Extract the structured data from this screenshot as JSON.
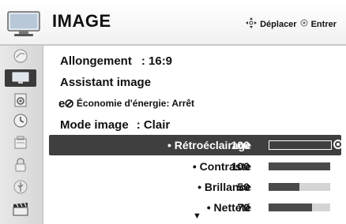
{
  "header": {
    "title": "IMAGE",
    "nav_move": "Déplacer",
    "nav_enter": "Entrer",
    "move_icon": "dpad-icon",
    "enter_icon": "ok-circle-icon"
  },
  "sidebar": {
    "items": [
      {
        "icon": "satellite-dish-icon",
        "active": false
      },
      {
        "icon": "tv-screen-icon",
        "active": true
      },
      {
        "icon": "speaker-icon",
        "active": false
      },
      {
        "icon": "clock-icon",
        "active": false
      },
      {
        "icon": "options-icon",
        "active": false
      },
      {
        "icon": "lock-icon",
        "active": false
      },
      {
        "icon": "usb-icon",
        "active": false
      },
      {
        "icon": "movie-clapper-icon",
        "active": false
      }
    ]
  },
  "menu": {
    "aspect_label": "Allongement",
    "aspect_value": ": 16:9",
    "assistant_label": "Assistant image",
    "energy_logo": "e⊘",
    "energy_label": "Économie d'énergie: Arrêt",
    "mode_label": "Mode image",
    "mode_value": ": Clair",
    "settings": [
      {
        "label": "• Rétroéclairage",
        "value": "100",
        "level": 1.0,
        "selected": true
      },
      {
        "label": "• Contraste",
        "value": "100",
        "level": 1.0,
        "selected": false
      },
      {
        "label": "• Brillance",
        "value": "50",
        "level": 0.5,
        "selected": false
      },
      {
        "label": "• Netteté",
        "value": "70",
        "level": 0.7,
        "selected": false
      }
    ],
    "more_indicator": "▼"
  },
  "colors": {
    "selected_bg": "#3f3f3f",
    "bar_fill": "#4a4a4a",
    "bar_track": "#d4d4d4"
  }
}
